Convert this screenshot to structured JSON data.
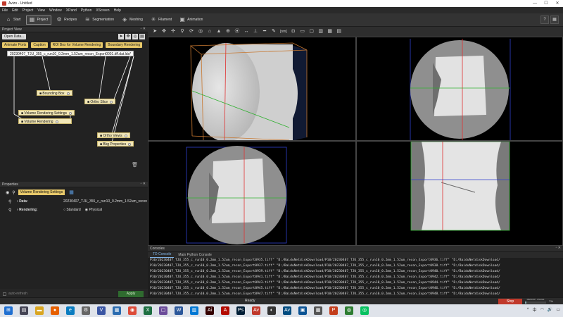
{
  "window": {
    "title": "Avizo - Untitled",
    "controls": [
      "—",
      "☐",
      "✕"
    ]
  },
  "menu": [
    "File",
    "Edit",
    "Project",
    "View",
    "Window",
    "XPand",
    "Python",
    "XScreen",
    "Help"
  ],
  "workroom": [
    {
      "label": "Start",
      "icon": "home-icon",
      "glyph": "⌂"
    },
    {
      "label": "Project",
      "icon": "project-icon",
      "glyph": "▦",
      "active": true
    },
    {
      "label": "Recipes",
      "icon": "recipes-icon",
      "glyph": "⚙"
    },
    {
      "label": "Segmentation",
      "icon": "segmentation-icon",
      "glyph": "≋"
    },
    {
      "label": "Meshing",
      "icon": "meshing-icon",
      "glyph": "◈"
    },
    {
      "label": "Filament",
      "icon": "filament-icon",
      "glyph": "✳"
    },
    {
      "label": "Animation",
      "icon": "animation-icon",
      "glyph": "▣"
    }
  ],
  "project": {
    "title": "Project View",
    "open_data": "Open Data...",
    "quick": [
      "Animate Ports",
      "Caption",
      "ROI Box for Volume Rendering",
      "Boundary Rendering"
    ],
    "nodes": {
      "data": "20230407_TJU_355_c_run10_0.2mm_1.52um_recon_Export0001.tiff.dat.lda*",
      "bbox": "Bounding Box",
      "ortho": "Ortho Slice",
      "vrs": "Volume Rendering Settings",
      "vr": "Volume Rendering",
      "orthoviews": "Ortho Views",
      "bkg": "Bkg Properties"
    }
  },
  "properties": {
    "title": "Properties",
    "module": "Volume Rendering Settings",
    "data_label": "Data:",
    "data_value": "20230407_TJU_355_c_run10_0.2mm_1.52um_recon",
    "rendering_label": "Rendering:",
    "rendering_options": [
      "Standard",
      "Physical"
    ],
    "auto_refresh": "auto-refresh",
    "apply": "Apply"
  },
  "viewer": {
    "unit": "[nm]"
  },
  "consoles": {
    "title": "Consoles",
    "tabs": [
      "TD Console",
      "Main Python Console"
    ],
    "lines": [
      "P10/20230407_TJU_355_c_run10_0.2mm_1.52um_recon_Export0935.tiff\" \"D:/BaiduNetdiskDownload/P10/20230407_TJU_355_c_run10_0.2mm_1.52um_recon_Export0936.tiff\" \"D:/BaiduNetdiskDownload/",
      "P10/20230407_TJU_355_c_run10_0.2mm_1.52um_recon_Export0937.tiff\" \"D:/BaiduNetdiskDownload/P10/20230407_TJU_355_c_run10_0.2mm_1.52um_recon_Export0938.tiff\" \"D:/BaiduNetdiskDownload/",
      "P10/20230407_TJU_355_c_run10_0.2mm_1.52um_recon_Export0939.tiff\" \"D:/BaiduNetdiskDownload/P10/20230407_TJU_355_c_run10_0.2mm_1.52um_recon_Export0940.tiff\" \"D:/BaiduNetdiskDownload/",
      "P10/20230407_TJU_355_c_run10_0.2mm_1.52um_recon_Export0941.tiff\" \"D:/BaiduNetdiskDownload/P10/20230407_TJU_355_c_run10_0.2mm_1.52um_recon_Export0942.tiff\" \"D:/BaiduNetdiskDownload/",
      "P10/20230407_TJU_355_c_run10_0.2mm_1.52um_recon_Export0943.tiff\" \"D:/BaiduNetdiskDownload/P10/20230407_TJU_355_c_run10_0.2mm_1.52um_recon_Export0944.tiff\" \"D:/BaiduNetdiskDownload/",
      "P10/20230407_TJU_355_c_run10_0.2mm_1.52um_recon_Export0945.tiff\" \"D:/BaiduNetdiskDownload/P10/20230407_TJU_355_c_run10_0.2mm_1.52um_recon_Export0946.tiff\" \"D:/BaiduNetdiskDownload/",
      "P10/20230407_TJU_355_c_run10_0.2mm_1.52um_recon_Export0947.tiff\" \"D:/BaiduNetdiskDownload/P10/20230407_TJU_355_c_run10_0.2mm_1.52um_recon_Export0948.tiff\" \"D:/BaiduNetdiskDownload/"
    ]
  },
  "status": {
    "text": "Ready",
    "stop": "Stop",
    "memory_label": "MEMORY USAGE",
    "memory_pct": "7%",
    "memory_fraction": 0.07
  },
  "taskbar": {
    "apps": [
      {
        "icon": "windows-start-icon",
        "color": "#1f6fd1",
        "glyph": "⊞"
      },
      {
        "icon": "calendar-icon",
        "color": "#445",
        "glyph": "▤"
      },
      {
        "icon": "explorer-icon",
        "color": "#d9a520",
        "glyph": "▬"
      },
      {
        "icon": "firefox-icon",
        "color": "#e66000",
        "glyph": "●"
      },
      {
        "icon": "edge-icon",
        "color": "#0a7cc0",
        "glyph": "e"
      },
      {
        "icon": "settings-icon",
        "color": "#666",
        "glyph": "⚙"
      },
      {
        "icon": "visio-icon",
        "color": "#3955a3",
        "glyph": "V"
      },
      {
        "icon": "notes-icon",
        "color": "#2b6cb0",
        "glyph": "▦"
      },
      {
        "icon": "chrome-icon",
        "color": "#dd4b39",
        "glyph": "◉"
      },
      {
        "icon": "excel-icon",
        "color": "#1d6f42",
        "glyph": "X"
      },
      {
        "icon": "app-icon",
        "color": "#6b4c9a",
        "glyph": "▢"
      },
      {
        "icon": "word-icon",
        "color": "#2b579a",
        "glyph": "W"
      },
      {
        "icon": "photos-icon",
        "color": "#0078d4",
        "glyph": "▥"
      },
      {
        "icon": "illustrator-icon",
        "color": "#330000",
        "glyph": "Ai"
      },
      {
        "icon": "acrobat-icon",
        "color": "#b30b00",
        "glyph": "A"
      },
      {
        "icon": "photoshop-icon",
        "color": "#001e36",
        "glyph": "Ps"
      },
      {
        "icon": "avizo-icon",
        "color": "#c0392b",
        "glyph": "Av"
      },
      {
        "icon": "blender-icon",
        "color": "#333",
        "glyph": "◐"
      },
      {
        "icon": "amira-icon",
        "color": "#004c80",
        "glyph": "Av"
      },
      {
        "icon": "paint-icon",
        "color": "#0b5394",
        "glyph": "▣"
      },
      {
        "icon": "store-icon",
        "color": "#555",
        "glyph": "▦"
      },
      {
        "icon": "powerpoint-icon",
        "color": "#c43e1c",
        "glyph": "P"
      },
      {
        "icon": "maps-icon",
        "color": "#2e7d32",
        "glyph": "◍"
      },
      {
        "icon": "wechat-icon",
        "color": "#07c160",
        "glyph": "◎"
      }
    ]
  }
}
